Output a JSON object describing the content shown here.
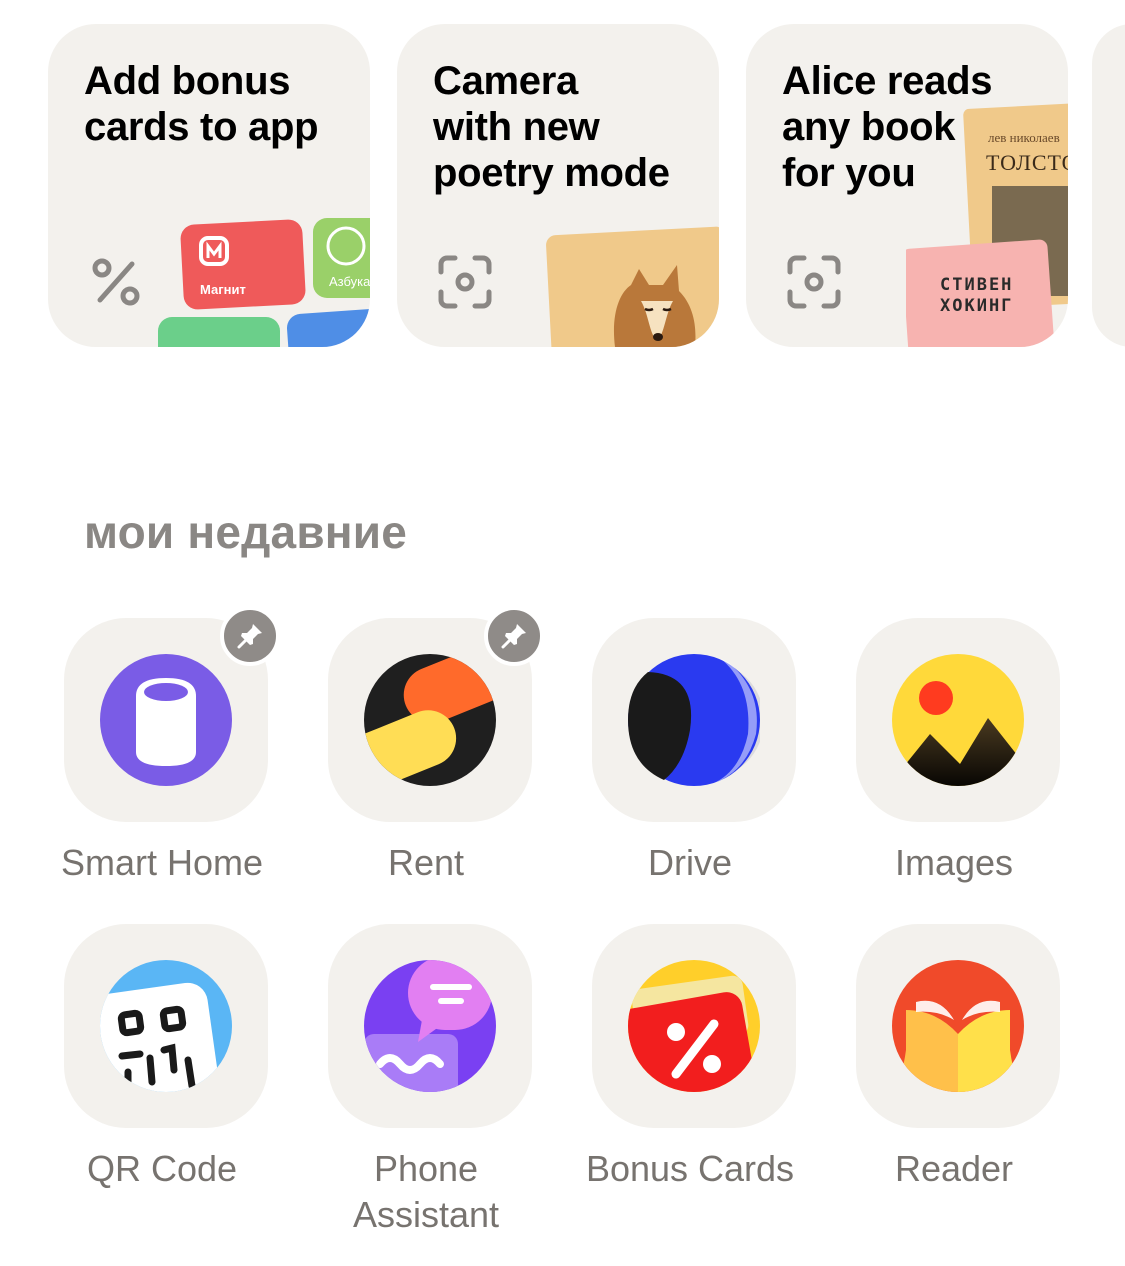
{
  "promos": [
    {
      "title_lines": [
        "Add bonus",
        "cards to app"
      ],
      "icon": "percent-icon",
      "card_labels": [
        "Магнит",
        "Азбука"
      ]
    },
    {
      "title_lines": [
        "Camera",
        "with new",
        "poetry mode"
      ],
      "icon": "camera-scan-icon"
    },
    {
      "title_lines": [
        "Alice reads",
        "any book",
        "for you"
      ],
      "icon": "camera-scan-icon",
      "books": [
        {
          "author": "лев николаев",
          "title": "ТОЛСТО"
        },
        {
          "title_lines": [
            "СТИВЕН",
            "ХОКИНГ"
          ]
        }
      ]
    }
  ],
  "recent": {
    "title": "мои недавние",
    "apps": [
      {
        "label": "Smart Home",
        "icon": "smart-home-icon",
        "pinned": true
      },
      {
        "label": "Rent",
        "icon": "rent-icon",
        "pinned": true
      },
      {
        "label": "Drive",
        "icon": "drive-icon",
        "pinned": false
      },
      {
        "label": "Images",
        "icon": "images-icon",
        "pinned": false
      },
      {
        "label": "QR Code",
        "icon": "qr-code-icon",
        "pinned": false
      },
      {
        "label": "Phone\nAssistant",
        "icon": "phone-assistant-icon",
        "pinned": false
      },
      {
        "label": "Bonus Cards",
        "icon": "bonus-cards-icon",
        "pinned": false
      },
      {
        "label": "Reader",
        "icon": "reader-icon",
        "pinned": false
      }
    ]
  },
  "colors": {
    "tile_bg": "#f3f1ed",
    "label_gray": "#77736f",
    "section_gray": "#8a8784",
    "pin_gray": "#8f8b88"
  }
}
